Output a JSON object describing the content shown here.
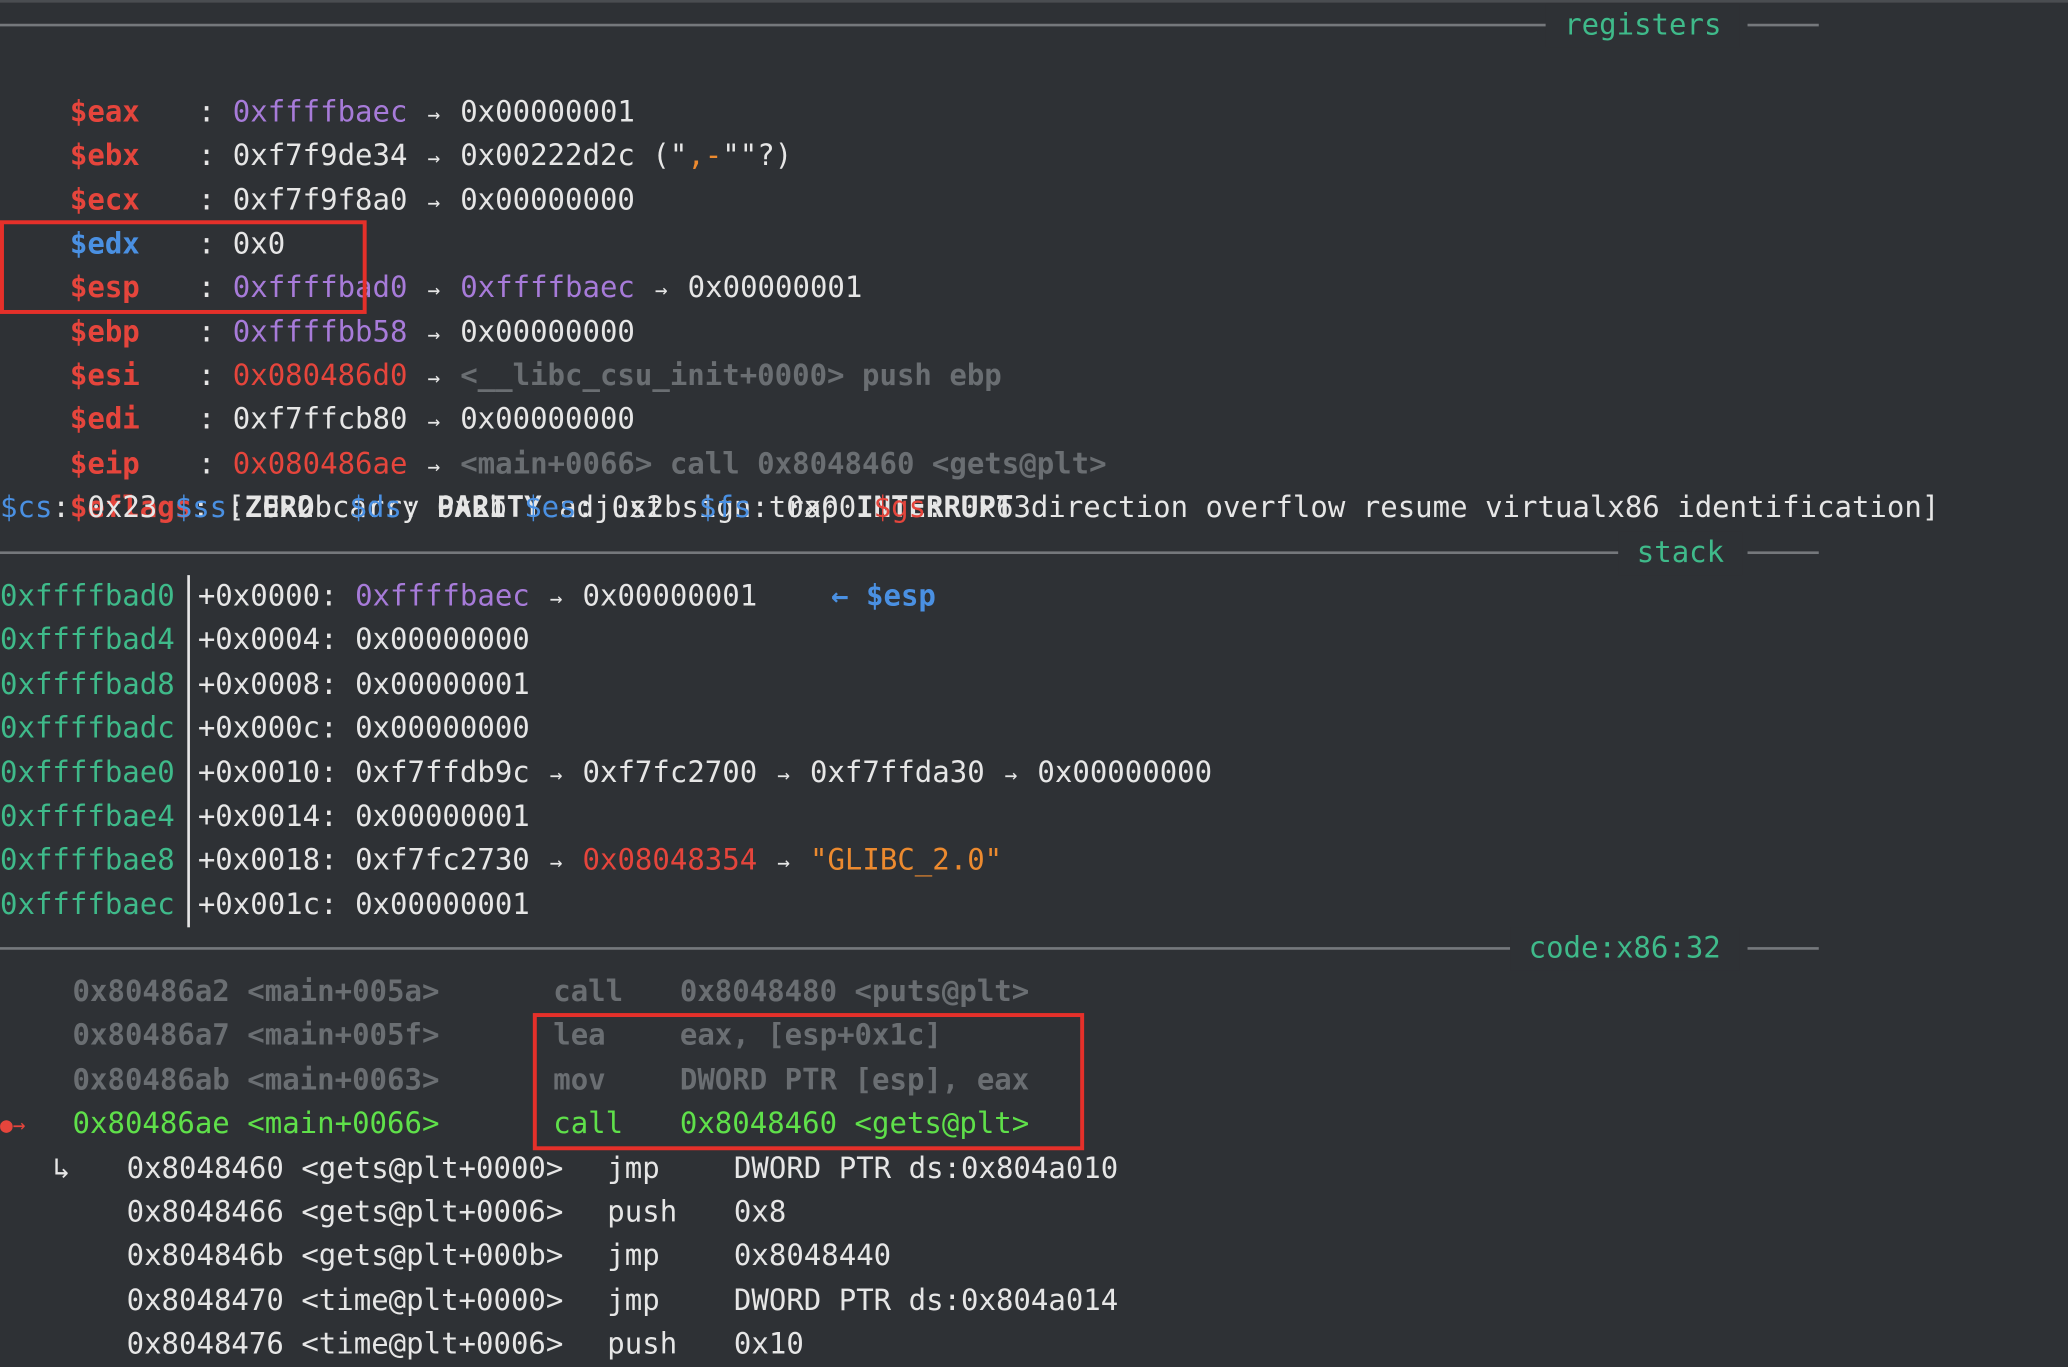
{
  "sections": {
    "registers": "registers",
    "stack": "stack",
    "code": "code:x86:32"
  },
  "registers": [
    {
      "name": "$eax",
      "value": "0xffffbaec",
      "chain": [
        "0x00000001"
      ]
    },
    {
      "name": "$ebx",
      "value": "0xf7f9de34",
      "chain": [
        "0x00222d2c"
      ],
      "extra_prefix": " (\"",
      "extra_mid": ",-",
      "extra_suffix": "\"\"?)"
    },
    {
      "name": "$ecx",
      "value": "0xf7f9f8a0",
      "chain": [
        "0x00000000"
      ]
    },
    {
      "name": "$edx",
      "value": "0x0"
    },
    {
      "name": "$esp",
      "value": "0xffffbad0",
      "chain": [
        "0xffffbaec",
        "0x00000001"
      ]
    },
    {
      "name": "$ebp",
      "value": "0xffffbb58",
      "chain": [
        "0x00000000"
      ]
    },
    {
      "name": "$esi",
      "value": "0x080486d0",
      "chain": [
        "<__libc_csu_init+0000> push ebp"
      ]
    },
    {
      "name": "$edi",
      "value": "0xf7ffcb80",
      "chain": [
        "0x00000000"
      ]
    },
    {
      "name": "$eip",
      "value": "0x080486ae",
      "chain": [
        "<main+0066> call 0x8048460 <gets@plt>"
      ]
    }
  ],
  "eflags": {
    "label": "$eflags",
    "open": "[",
    "close": "]",
    "flags": [
      {
        "name": "ZERO",
        "set": true
      },
      {
        "name": "carry",
        "set": false
      },
      {
        "name": "PARITY",
        "set": true
      },
      {
        "name": "adjust",
        "set": false
      },
      {
        "name": "sign",
        "set": false
      },
      {
        "name": "trap",
        "set": false
      },
      {
        "name": "INTERRUPT",
        "set": true
      },
      {
        "name": "direction",
        "set": false
      },
      {
        "name": "overflow",
        "set": false
      },
      {
        "name": "resume",
        "set": false
      },
      {
        "name": "virtualx86",
        "set": false
      },
      {
        "name": "identification",
        "set": false
      }
    ]
  },
  "segments": [
    {
      "name": "$cs",
      "value": "0x23"
    },
    {
      "name": "$ss",
      "value": "0x2b"
    },
    {
      "name": "$ds",
      "value": "0x2b"
    },
    {
      "name": "$es",
      "value": "0x2b"
    },
    {
      "name": "$fs",
      "value": "0x00"
    },
    {
      "name": "$gs",
      "value": "0x63"
    }
  ],
  "stack": [
    {
      "addr": "0xffffbad0",
      "offset": "+0x0000:",
      "value": "0xffffbaec",
      "chain": [
        "0x00000001"
      ],
      "marker": "← $esp"
    },
    {
      "addr": "0xffffbad4",
      "offset": "+0x0004:",
      "value": "0x00000000"
    },
    {
      "addr": "0xffffbad8",
      "offset": "+0x0008:",
      "value": "0x00000001"
    },
    {
      "addr": "0xffffbadc",
      "offset": "+0x000c:",
      "value": "0x00000000"
    },
    {
      "addr": "0xffffbae0",
      "offset": "+0x0010:",
      "value": "0xf7ffdb9c",
      "chain": [
        "0xf7fc2700",
        "0xf7ffda30",
        "0x00000000"
      ]
    },
    {
      "addr": "0xffffbae4",
      "offset": "+0x0014:",
      "value": "0x00000001"
    },
    {
      "addr": "0xffffbae8",
      "offset": "+0x0018:",
      "value": "0xf7fc2730",
      "chain": [
        "0x08048354",
        "\"GLIBC_2.0\""
      ]
    },
    {
      "addr": "0xffffbaec",
      "offset": "+0x001c:",
      "value": "0x00000001"
    }
  ],
  "code": {
    "past": [
      {
        "addr": "0x80486a2",
        "sym": "<main+005a>",
        "mnemonic": "call",
        "operand": "0x8048480 <puts@plt>"
      },
      {
        "addr": "0x80486a7",
        "sym": "<main+005f>",
        "mnemonic": "lea",
        "operand": "eax, [esp+0x1c]"
      },
      {
        "addr": "0x80486ab",
        "sym": "<main+0063>",
        "mnemonic": "mov",
        "operand": "DWORD PTR [esp], eax"
      }
    ],
    "current": {
      "marker": "●→",
      "addr": "0x80486ae",
      "sym": "<main+0066>",
      "mnemonic": "call",
      "operand": "0x8048460 <gets@plt>"
    },
    "branch_marker": "↳",
    "target": [
      {
        "addr": "0x8048460",
        "sym": "<gets@plt+0000>",
        "mnemonic": "jmp",
        "operand": "DWORD PTR ds:0x804a010"
      },
      {
        "addr": "0x8048466",
        "sym": "<gets@plt+0006>",
        "mnemonic": "push",
        "operand": "0x8"
      },
      {
        "addr": "0x804846b",
        "sym": "<gets@plt+000b>",
        "mnemonic": "jmp",
        "operand": "0x8048440"
      },
      {
        "addr": "0x8048470",
        "sym": "<time@plt+0000>",
        "mnemonic": "jmp",
        "operand": "DWORD PTR ds:0x804a014"
      },
      {
        "addr": "0x8048476",
        "sym": "<time@plt+0006>",
        "mnemonic": "push",
        "operand": "0x10"
      }
    ]
  },
  "arrow_glyph": "→",
  "colors": {
    "background": "#2e3135",
    "section_label": "#3fba8a",
    "changed_register": "#e5453c",
    "pointer": "#a77bd9",
    "segment_name": "#4a90e2",
    "current_instruction": "#5fe04a",
    "past_instruction": "#6a6e72",
    "string": "#ec8a2f",
    "highlight_box": "#e5302a"
  }
}
